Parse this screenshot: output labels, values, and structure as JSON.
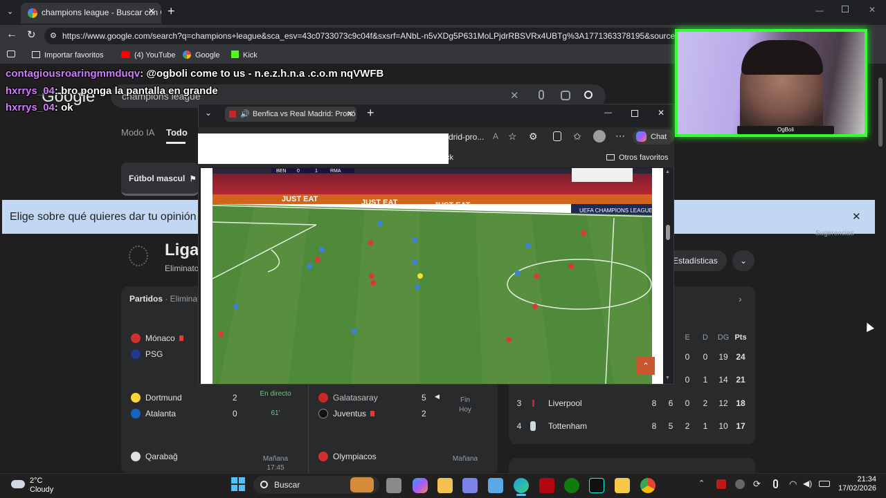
{
  "browser": {
    "tab_title": "champions league - Buscar con Google",
    "url": "https://www.google.com/search?q=champions+league&sca_esv=43c0733073c9c04f&sxsrf=ANbL-n5vXDg5P631MoLPjdrRBSVRx4UBTg%3A1771363378195&source=hp&",
    "bookmarks": [
      "Importar favoritos",
      "(4) YouTube",
      "Google",
      "Kick"
    ]
  },
  "google": {
    "logo": "Google",
    "search_query": "champions league",
    "nav": [
      "Modo IA",
      "Todo"
    ],
    "chip": "Fútbol mascul",
    "feedback": "Elige sobre qué quieres dar tu opinión",
    "sugerencias": "Sugerencias",
    "title": "Liga",
    "subtitle": "Eliminato",
    "estadisticas": "Estadísticas",
    "partidos_label": "Partidos",
    "partidos_sub": " · Eliminato",
    "matches": [
      {
        "home": "Mónaco",
        "away": "PSG",
        "home_score": "",
        "away_score": "",
        "status": "",
        "time": ""
      },
      {
        "home": "Dortmund",
        "away": "Atalanta",
        "home_score": "2",
        "away_score": "0",
        "status": "En directo",
        "time": "61'"
      },
      {
        "home": "Galatasaray",
        "away": "Juventus",
        "home_score": "5",
        "away_score": "2",
        "status": "Fin",
        "time": "Hoy"
      },
      {
        "home": "Qarabağ",
        "away": "",
        "home_score": "",
        "away_score": "",
        "status": "Mañana",
        "time": "17:45"
      },
      {
        "home": "Olympiacos",
        "away": "",
        "home_score": "",
        "away_score": "",
        "status": "Mañana",
        "time": ""
      }
    ],
    "standings": {
      "headers": [
        "E",
        "D",
        "DG",
        "Pts"
      ],
      "rows": [
        {
          "pos": "",
          "team": "",
          "pj": "",
          "g": "",
          "e": "0",
          "d": "0",
          "dg": "19",
          "pts": "24"
        },
        {
          "pos": "",
          "team": "",
          "pj": "",
          "g": "",
          "e": "0",
          "d": "1",
          "dg": "14",
          "pts": "21"
        },
        {
          "pos": "3",
          "team": "Liverpool",
          "pj": "8",
          "g": "6",
          "e": "0",
          "d": "2",
          "dg": "12",
          "pts": "18"
        },
        {
          "pos": "4",
          "team": "Tottenham",
          "pj": "8",
          "g": "5",
          "e": "2",
          "d": "1",
          "dg": "10",
          "pts": "17"
        }
      ]
    }
  },
  "chat": [
    {
      "user": "contagiousroaringmmduqv",
      "message": "@ogboli come to us - n.e.z.h.n.a .c.o.m nqVWFB"
    },
    {
      "user": "hxrrys_04",
      "message": "bro ponga la pantalla en grande"
    },
    {
      "user": "hxrrys_04",
      "message": "ok"
    }
  ],
  "edge": {
    "tab_title": "Benfica vs Real Madrid: Pronó",
    "url_fragment": "drid-pro...",
    "copilot": "Chat",
    "bookmark_partial": "ck",
    "otros_favoritos": "Otros favoritos",
    "ads": [
      "JUST EAT",
      "JUST EAT",
      "JUST EAT",
      "JUST EAT"
    ],
    "ucl": "UEFA CHAMPIONS LEAGUE",
    "scoreboard": {
      "home": "BEN",
      "home_score": "0",
      "away_score": "1",
      "away": "RMA"
    }
  },
  "webcam": {
    "name": "OgBoli"
  },
  "taskbar": {
    "weather_temp": "2°C",
    "weather_desc": "Cloudy",
    "search": "Buscar",
    "time": "21:34",
    "date": "17/02/2026"
  },
  "colors": {
    "pitch": "#4f8a3a",
    "chat_user": "#d47cff",
    "cam_border": "#33ff33",
    "feedback_bar": "#c2d7f4"
  }
}
